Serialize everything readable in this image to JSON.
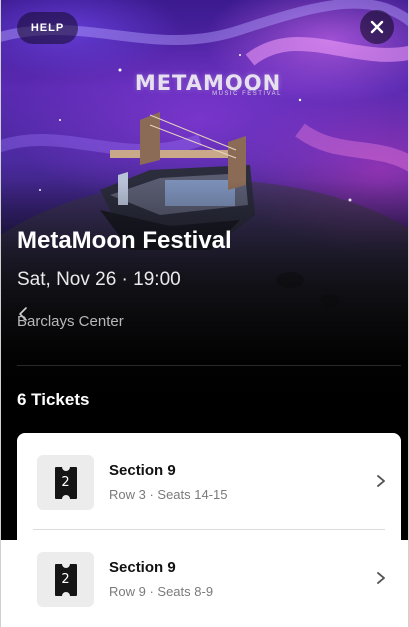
{
  "header": {
    "help_label": "HELP",
    "close_icon": "close-icon"
  },
  "artwork": {
    "logo_main": "METAMOON",
    "logo_sub": "MUSIC FESTIVAL"
  },
  "event": {
    "title": "MetaMoon Festival",
    "date_time": "Sat, Nov 26 · 19:00",
    "venue": "Barclays Center"
  },
  "tickets": {
    "count_label": "6 Tickets",
    "items": [
      {
        "quantity": "2",
        "section": "Section 9",
        "seats": "Row 3 · Seats 14-15"
      },
      {
        "quantity": "2",
        "section": "Section 9",
        "seats": "Row 9 · Seats 8-9"
      }
    ]
  },
  "colors": {
    "background": "#000000",
    "accent_purple": "#5a2ab2",
    "card_bg": "#ffffff",
    "thumb_bg": "#ececec"
  }
}
